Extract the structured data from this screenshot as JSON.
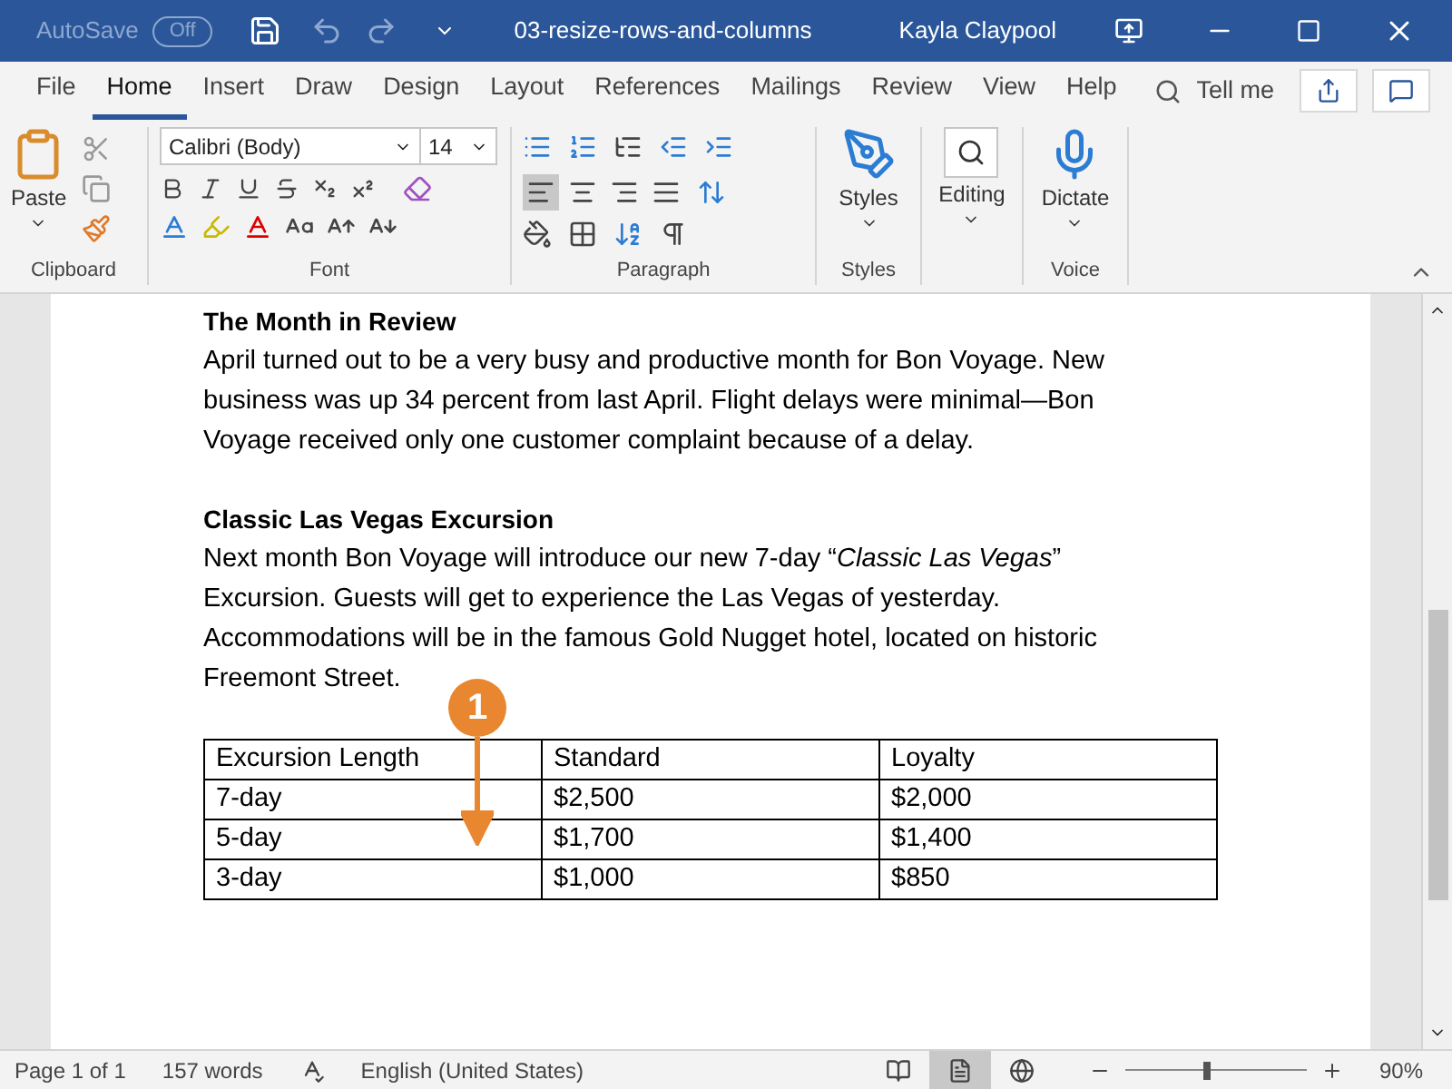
{
  "title_bar": {
    "autosave_label": "AutoSave",
    "autosave": {
      "label": "Off",
      "on": false
    },
    "title": "03-resize-rows-and-columns",
    "user": "Kayla Claypool"
  },
  "menu_tabs": [
    {
      "label": "File",
      "selected": false
    },
    {
      "label": "Home",
      "selected": true
    },
    {
      "label": "Insert",
      "selected": false
    },
    {
      "label": "Draw",
      "selected": false
    },
    {
      "label": "Design",
      "selected": false
    },
    {
      "label": "Layout",
      "selected": false
    },
    {
      "label": "References",
      "selected": false
    },
    {
      "label": "Mailings",
      "selected": false
    },
    {
      "label": "Review",
      "selected": false
    },
    {
      "label": "View",
      "selected": false
    },
    {
      "label": "Help",
      "selected": false
    }
  ],
  "tell_me": "Tell me",
  "ribbon": {
    "clipboard": {
      "paste": "Paste",
      "label": "Clipboard"
    },
    "font": {
      "font_name": "Calibri (Body)",
      "font_size": "14",
      "label": "Font"
    },
    "paragraph": {
      "label": "Paragraph",
      "alignments": [
        {
          "selected": true
        },
        {
          "selected": false
        },
        {
          "selected": false
        },
        {
          "selected": false
        }
      ]
    },
    "styles": {
      "button": "Styles",
      "label": "Styles"
    },
    "editing": {
      "button": "Editing"
    },
    "voice": {
      "button": "Dictate",
      "label": "Voice"
    }
  },
  "document": {
    "blocks": [
      {
        "kind": "heading",
        "text": "The Month in Review"
      },
      {
        "kind": "paragraph",
        "text": "April turned out to be a very busy and productive month for Bon Voyage. New business was up 34 percent from last April. Flight delays were minimal—Bon Voyage received only one customer complaint because of a delay."
      },
      {
        "kind": "heading",
        "text": "Classic Las Vegas Excursion"
      },
      {
        "kind": "paragraph",
        "text": "Next month Bon Voyage will introduce our new 7-day “*Classic Las Vegas*” Excursion. Guests will get to experience the Las Vegas of yesterday. Accommodations will be in the famous Gold Nugget hotel, located on historic Freemont Street."
      }
    ],
    "table": {
      "columns": [
        "Excursion Length",
        "Standard",
        "Loyalty"
      ],
      "rows": [
        [
          "7-day",
          "$2,500",
          "$2,000"
        ],
        [
          "5-day",
          "$1,700",
          "$1,400"
        ],
        [
          "3-day",
          "$1,000",
          "$850"
        ]
      ]
    },
    "callout": "1"
  },
  "status_bar": {
    "page": "Page 1 of 1",
    "words": "157 words",
    "language": "English (United States)",
    "views": [
      {
        "kind": "read",
        "selected": false
      },
      {
        "kind": "print",
        "selected": true
      },
      {
        "kind": "web",
        "selected": false
      }
    ],
    "zoom": {
      "level": 0.43
    },
    "zoom_label": "90%"
  }
}
